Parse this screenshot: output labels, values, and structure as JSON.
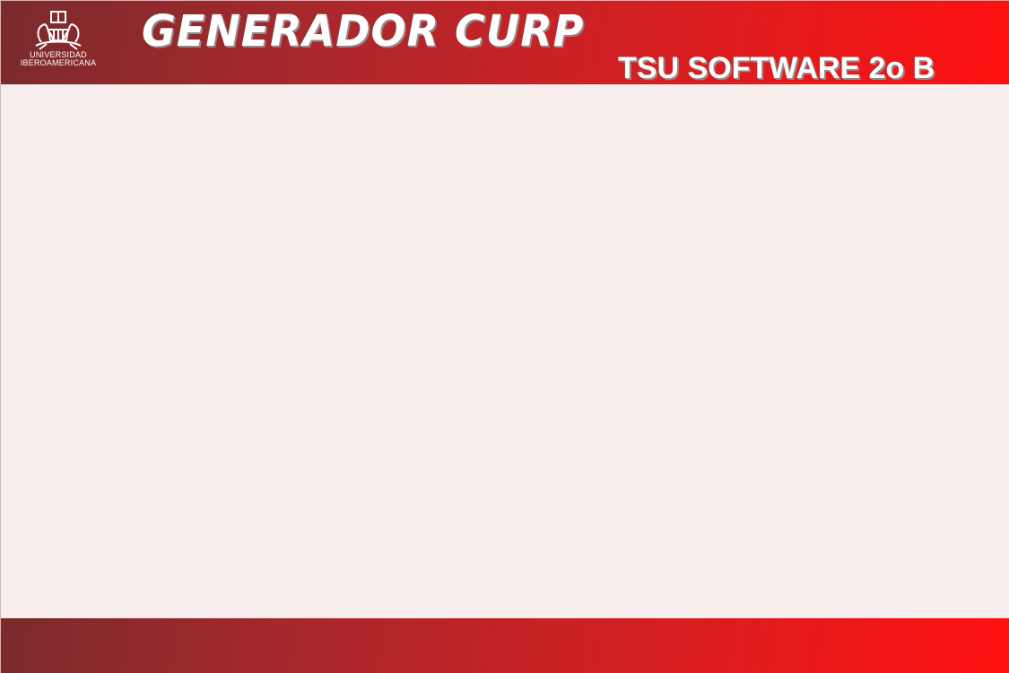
{
  "header": {
    "logo": {
      "icon": "university-crest-icon",
      "line1": "UNIVERSIDAD",
      "line2": "IBEROAMERICANA"
    },
    "title": "GENERADOR CURP",
    "group": "TSU SOFTWARE 2o B"
  },
  "colors": {
    "banner_dark": "#7a2a2c",
    "banner_bright": "#ff1010",
    "background": "#f8eded",
    "text": "#ffffff"
  }
}
